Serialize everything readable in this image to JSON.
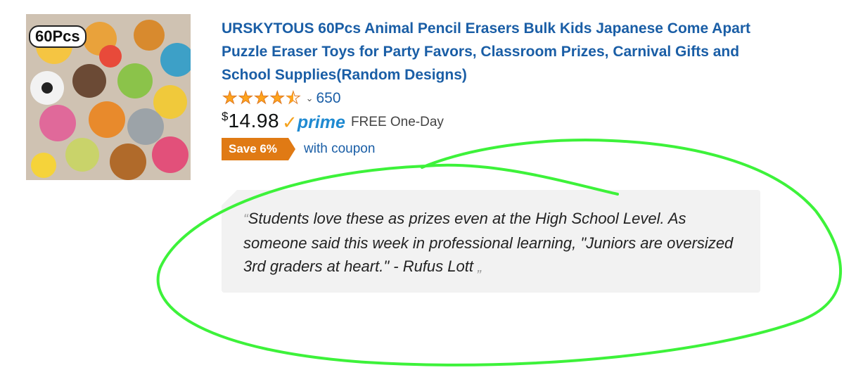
{
  "product": {
    "image_badge": "60Pcs",
    "title": "URSKYTOUS 60Pcs Animal Pencil Erasers Bulk Kids Japanese Come Apart Puzzle Eraser Toys for Party Favors, Classroom Prizes, Carnival Gifts and School Supplies(Random Designs)",
    "rating": 4.5,
    "review_count": "650",
    "price_symbol": "$",
    "price": "14.98",
    "prime_check": "✓",
    "prime_label": "prime",
    "shipping": "FREE One-Day",
    "save_badge": "Save 6%",
    "coupon_text": "with coupon"
  },
  "review": {
    "open_quote": "“",
    "text": "Students love these as prizes even at the High School Level. As someone said this week in professional learning, \"Juniors are oversized 3rd graders at heart.\" - Rufus Lott",
    "close_quote": "„"
  },
  "colors": {
    "link_blue": "#1a5ea6",
    "star_orange": "#ffa41c",
    "save_orange": "#e07a14",
    "prime_blue": "#1f8ad1",
    "annotation_green": "#3df23a",
    "quote_bg": "#f2f2f2"
  },
  "icons": {
    "star": "star-icon",
    "half_star": "star-half-icon",
    "chevron": "chevron-down-icon",
    "prime_check": "prime-check-icon"
  }
}
